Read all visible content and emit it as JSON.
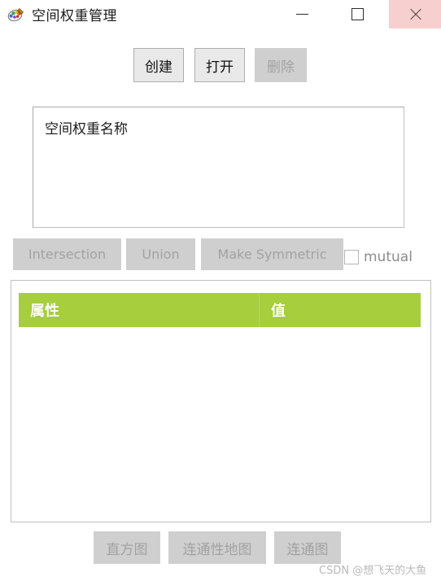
{
  "window": {
    "title": "空间权重管理",
    "icon": "app-palette-icon",
    "controls": {
      "minimize": "minimize-icon",
      "maximize": "maximize-icon",
      "close": "close-icon",
      "close_bg": "#F7CFCF"
    }
  },
  "toolbar": {
    "buttons": [
      {
        "label": "创建",
        "enabled": true
      },
      {
        "label": "打开",
        "enabled": true
      },
      {
        "label": "删除",
        "enabled": false
      }
    ]
  },
  "weights_list": {
    "header": "空间权重名称",
    "items": []
  },
  "ops": {
    "buttons": [
      {
        "label": "Intersection",
        "enabled": false
      },
      {
        "label": "Union",
        "enabled": false
      },
      {
        "label": "Make Symmetric",
        "enabled": false
      }
    ],
    "checkbox": {
      "label": "mutual",
      "checked": false,
      "enabled": false
    }
  },
  "property_table": {
    "header_color": "#A6CE3D",
    "columns": [
      "属性",
      "值"
    ],
    "rows": []
  },
  "footer": {
    "buttons": [
      {
        "label": "直方图",
        "enabled": false
      },
      {
        "label": "连通性地图",
        "enabled": false
      },
      {
        "label": "连通图",
        "enabled": false
      }
    ]
  },
  "watermark": "CSDN @想飞天的大鱼"
}
